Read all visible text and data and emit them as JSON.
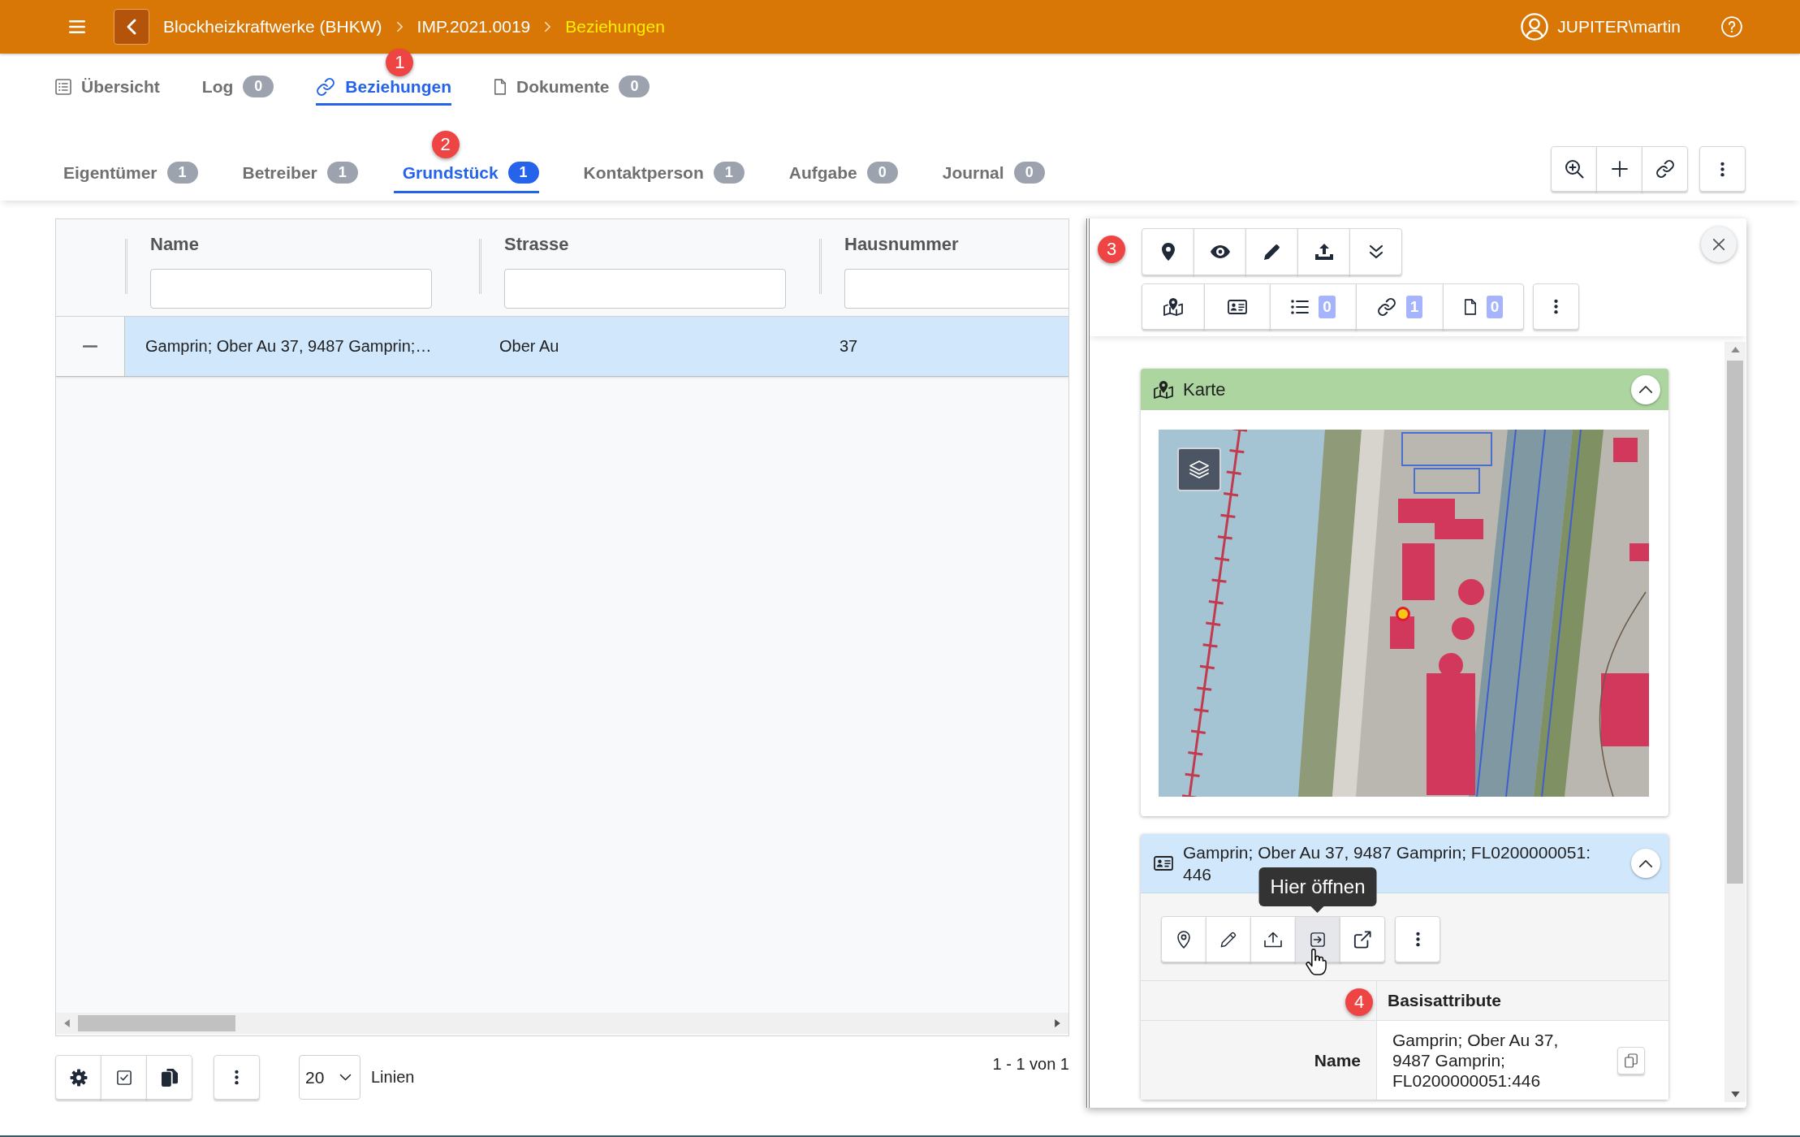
{
  "header": {
    "breadcrumbs": [
      {
        "label": "Blockheizkraftwerke (BHKW)",
        "current": false
      },
      {
        "label": "IMP.2021.0019",
        "current": false
      },
      {
        "label": "Beziehungen",
        "current": true
      }
    ],
    "user": "JUPITER\\martin"
  },
  "nav_tabs": [
    {
      "label": "Übersicht",
      "selected": false
    },
    {
      "label": "Log",
      "count": "0",
      "selected": false
    },
    {
      "label": "Beziehungen",
      "selected": true,
      "marker": "1"
    },
    {
      "label": "Dokumente",
      "count": "0",
      "selected": false
    }
  ],
  "sub_tabs": [
    {
      "label": "Eigentümer",
      "count": "1",
      "selected": false
    },
    {
      "label": "Betreiber",
      "count": "1",
      "selected": false
    },
    {
      "label": "Grundstück",
      "count": "1",
      "selected": true,
      "marker": "2"
    },
    {
      "label": "Kontaktperson",
      "count": "1",
      "selected": false
    },
    {
      "label": "Aufgabe",
      "count": "0",
      "selected": false
    },
    {
      "label": "Journal",
      "count": "0",
      "selected": false
    }
  ],
  "table": {
    "columns": [
      {
        "label": "Name"
      },
      {
        "label": "Strasse"
      },
      {
        "label": "Hausnummer"
      }
    ],
    "rows": [
      {
        "selected": true,
        "cells": [
          "Gamprin; Ober Au 37, 9487 Gamprin;…",
          "Ober Au",
          "37"
        ]
      }
    ]
  },
  "pagination": {
    "page_size": "20",
    "unit_label": "Linien",
    "range": "1 - 1 von 1"
  },
  "detail_panel": {
    "marker": "3",
    "section_counts": [
      "0",
      "1",
      "0"
    ],
    "cards": [
      {
        "kind": "map",
        "title": "Karte",
        "expanded": true
      },
      {
        "kind": "record",
        "title": "Gamprin; Ober Au 37, 9487 Gamprin; FL0200000051: 446",
        "expanded": true,
        "actions": [
          {
            "hovered": false
          },
          {
            "hovered": false
          },
          {
            "hovered": false
          },
          {
            "hovered": true,
            "tooltip": "Hier öffnen"
          },
          {
            "hovered": false
          }
        ],
        "attributes": {
          "section": "Basisattribute",
          "marker": "4",
          "rows": [
            {
              "label": "Name",
              "value": "Gamprin; Ober Au 37, 9487 Gamprin; FL0200000051:446"
            }
          ]
        }
      }
    ]
  }
}
